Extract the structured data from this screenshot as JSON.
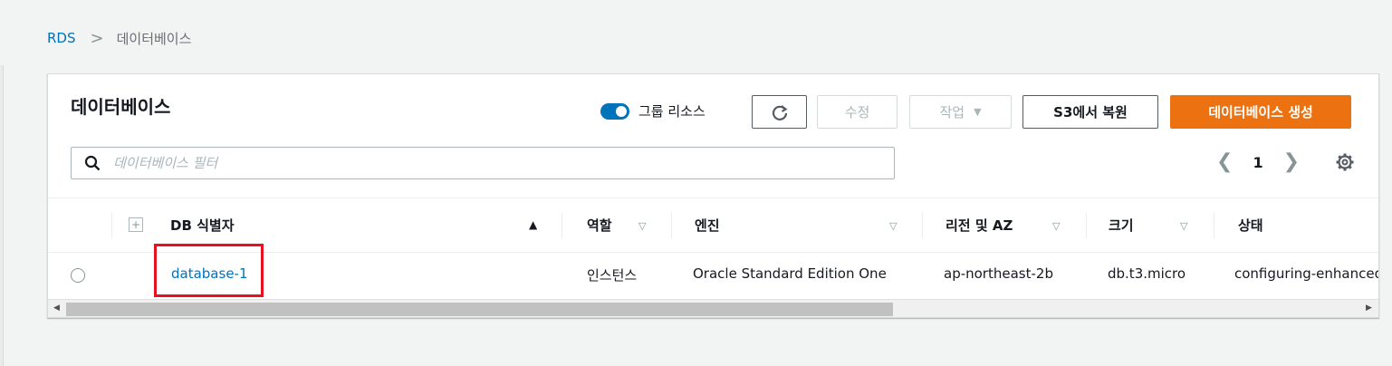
{
  "breadcrumb": {
    "root": "RDS",
    "separator": ">",
    "current": "데이터베이스"
  },
  "panel": {
    "title": "데이터베이스",
    "group_toggle_label": "그룹 리소스",
    "buttons": {
      "edit": "수정",
      "actions": "작업",
      "restore_s3": "S3에서 복원",
      "create": "데이터베이스 생성"
    },
    "search_placeholder": "데이터베이스 필터",
    "pagination": {
      "page": "1"
    }
  },
  "table": {
    "columns": [
      {
        "label": "DB 식별자"
      },
      {
        "label": "역할"
      },
      {
        "label": "엔진"
      },
      {
        "label": "리전 및 AZ"
      },
      {
        "label": "크기"
      },
      {
        "label": "상태"
      }
    ],
    "rows": [
      {
        "identifier": "database-1",
        "role": "인스턴스",
        "engine": "Oracle Standard Edition One",
        "region_az": "ap-northeast-2b",
        "size": "db.t3.micro",
        "status": "configuring-enhanced-monitoring"
      }
    ]
  },
  "colors": {
    "link": "#0073bb",
    "primary": "#ec7211",
    "highlight": "#e81123"
  }
}
